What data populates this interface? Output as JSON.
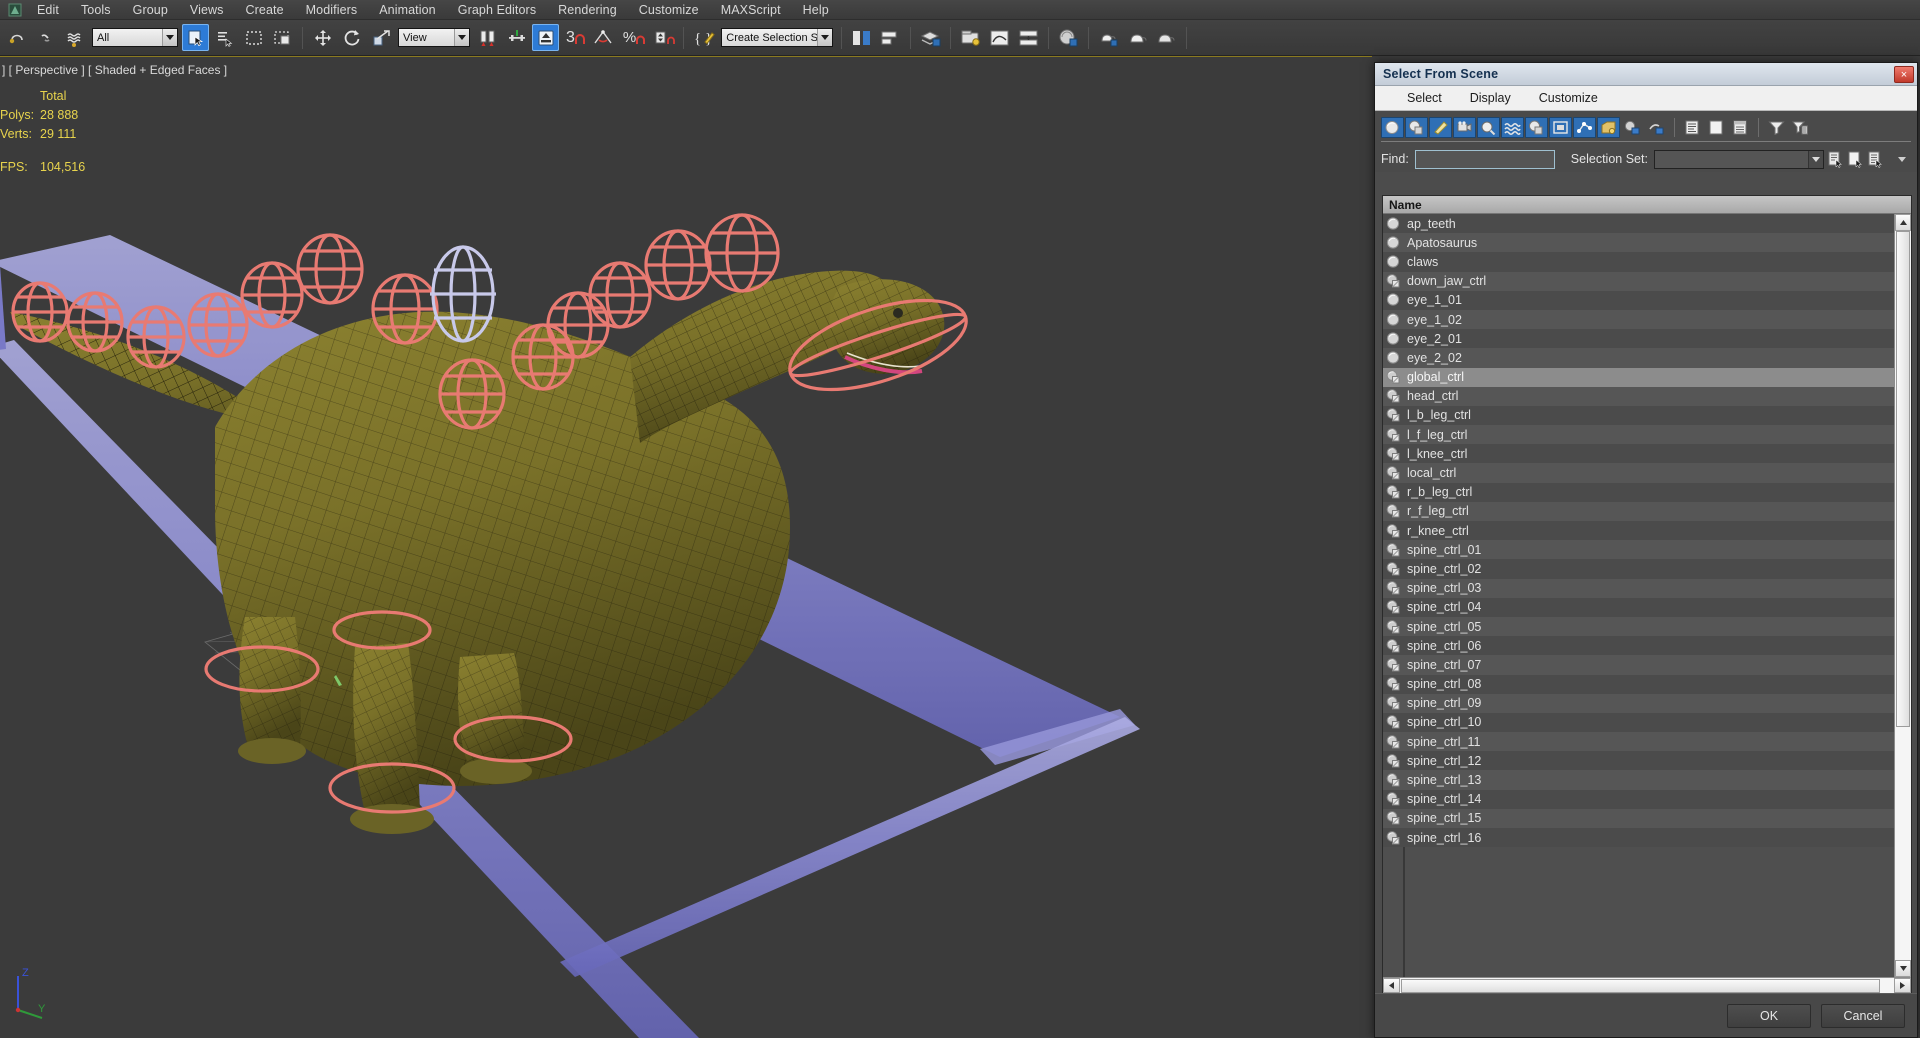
{
  "app": {
    "menu": [
      "Edit",
      "Tools",
      "Group",
      "Views",
      "Create",
      "Modifiers",
      "Animation",
      "Graph Editors",
      "Rendering",
      "Customize",
      "MAXScript",
      "Help"
    ],
    "toolbar": {
      "selection_filter_value": "All",
      "reference_coord_value": "View",
      "named_selection_set_value": "Create Selection Se",
      "snap_count_label": "3",
      "percent_label": "%"
    }
  },
  "viewport": {
    "label": "] [ Perspective ] [ Shaded + Edged Faces ]",
    "stats": {
      "col_header": "Total",
      "rows": [
        {
          "key": "Polys:",
          "value": "28 888"
        },
        {
          "key": "Verts:",
          "value": "29 111"
        }
      ],
      "fps_key": "FPS:",
      "fps_value": "104,516"
    },
    "axis": {
      "z": "Z",
      "y": "Y"
    },
    "colors": {
      "background": "#3b3b3b",
      "control_rig": "#e87a72",
      "selected_control": "#c3c4e8",
      "grid_plane": "#8b8bd8",
      "model_skin": "#7d7528",
      "model_wire": "#1d1d1d"
    }
  },
  "dialog": {
    "title": "Select From Scene",
    "close_label": "×",
    "menu": [
      "Select",
      "Display",
      "Customize"
    ],
    "find": {
      "label": "Find:",
      "value": "",
      "placeholder": ""
    },
    "selection_set": {
      "label": "Selection Set:",
      "value": "",
      "placeholder": ""
    },
    "filter_buttons": [
      "geometry-filter-icon",
      "shapes-filter-icon",
      "lights-filter-icon",
      "cameras-filter-icon",
      "helpers-filter-icon",
      "space-warps-filter-icon",
      "groups-filter-icon",
      "xrefs-filter-icon",
      "bones-filter-icon",
      "containers-filter-icon"
    ],
    "extra_buttons": [
      "select-influences-icon",
      "select-dependents-icon",
      "display-children-icon",
      "display-thumbnails-icon",
      "expand-all-icon",
      "filter-funnel-icon",
      "advanced-filter-icon"
    ],
    "selset_buttons": [
      "add-selection-set-icon",
      "remove-selection-set-icon",
      "edit-selection-set-icon"
    ],
    "list": {
      "column_header": "Name",
      "selected": "global_ctrl",
      "rows": [
        {
          "name": "ap_teeth",
          "icon": "geometry-icon"
        },
        {
          "name": "Apatosaurus",
          "icon": "geometry-icon"
        },
        {
          "name": "claws",
          "icon": "geometry-icon"
        },
        {
          "name": "down_jaw_ctrl",
          "icon": "shape-icon"
        },
        {
          "name": "eye_1_01",
          "icon": "geometry-icon"
        },
        {
          "name": "eye_1_02",
          "icon": "geometry-icon"
        },
        {
          "name": "eye_2_01",
          "icon": "geometry-icon"
        },
        {
          "name": "eye_2_02",
          "icon": "geometry-icon"
        },
        {
          "name": "global_ctrl",
          "icon": "shape-icon"
        },
        {
          "name": "head_ctrl",
          "icon": "shape-icon"
        },
        {
          "name": "l_b_leg_ctrl",
          "icon": "shape-icon"
        },
        {
          "name": "l_f_leg_ctrl",
          "icon": "shape-icon"
        },
        {
          "name": "l_knee_ctrl",
          "icon": "shape-icon"
        },
        {
          "name": "local_ctrl",
          "icon": "shape-icon"
        },
        {
          "name": "r_b_leg_ctrl",
          "icon": "shape-icon"
        },
        {
          "name": "r_f_leg_ctrl",
          "icon": "shape-icon"
        },
        {
          "name": "r_knee_ctrl",
          "icon": "shape-icon"
        },
        {
          "name": "spine_ctrl_01",
          "icon": "shape-icon"
        },
        {
          "name": "spine_ctrl_02",
          "icon": "shape-icon"
        },
        {
          "name": "spine_ctrl_03",
          "icon": "shape-icon"
        },
        {
          "name": "spine_ctrl_04",
          "icon": "shape-icon"
        },
        {
          "name": "spine_ctrl_05",
          "icon": "shape-icon"
        },
        {
          "name": "spine_ctrl_06",
          "icon": "shape-icon"
        },
        {
          "name": "spine_ctrl_07",
          "icon": "shape-icon"
        },
        {
          "name": "spine_ctrl_08",
          "icon": "shape-icon"
        },
        {
          "name": "spine_ctrl_09",
          "icon": "shape-icon"
        },
        {
          "name": "spine_ctrl_10",
          "icon": "shape-icon"
        },
        {
          "name": "spine_ctrl_11",
          "icon": "shape-icon"
        },
        {
          "name": "spine_ctrl_12",
          "icon": "shape-icon"
        },
        {
          "name": "spine_ctrl_13",
          "icon": "shape-icon"
        },
        {
          "name": "spine_ctrl_14",
          "icon": "shape-icon"
        },
        {
          "name": "spine_ctrl_15",
          "icon": "shape-icon"
        },
        {
          "name": "spine_ctrl_16",
          "icon": "shape-icon"
        }
      ]
    },
    "footer": {
      "ok": "OK",
      "cancel": "Cancel"
    }
  }
}
